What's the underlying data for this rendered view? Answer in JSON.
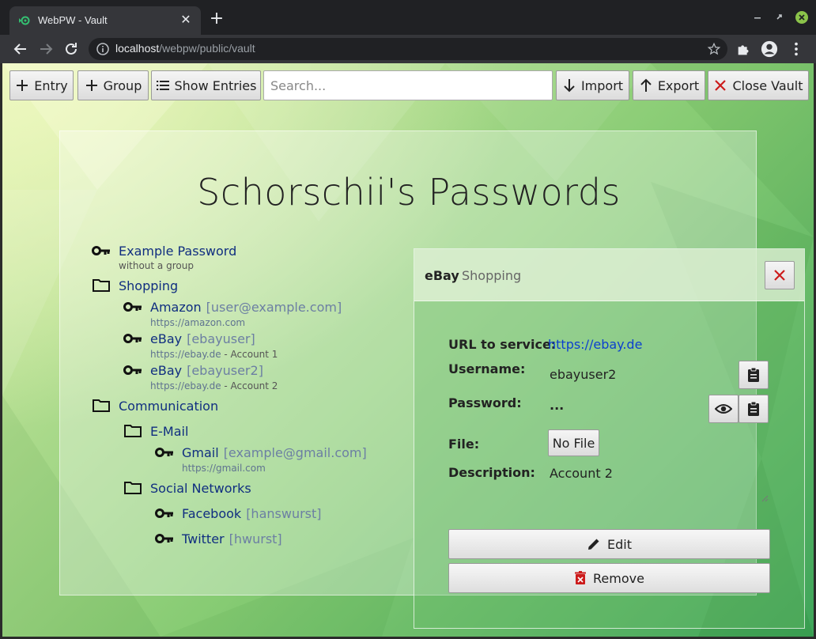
{
  "browser": {
    "tab_title": "WebPW - Vault",
    "tab_close": "✕",
    "new_tab": "+",
    "url_host": "localhost",
    "url_path": "/webpw/public/vault"
  },
  "topbar": {
    "entry_label": "Entry",
    "group_label": "Group",
    "show_entries_label": "Show Entries",
    "search_placeholder": "Search...",
    "import_label": "Import",
    "export_label": "Export",
    "close_vault_label": "Close Vault"
  },
  "vault": {
    "title": "Schorschii's Passwords",
    "tree": {
      "example": {
        "name": "Example Password",
        "sub": "without a group"
      },
      "shopping": {
        "name": "Shopping",
        "amazon": {
          "name": "Amazon",
          "user": "[user@example.com]",
          "url": "https://amazon.com"
        },
        "ebay1": {
          "name": "eBay",
          "user": "[ebayuser]",
          "url": "https://ebay.de",
          "desc": " - Account 1"
        },
        "ebay2": {
          "name": "eBay",
          "user": "[ebayuser2]",
          "url": "https://ebay.de",
          "desc": " - Account 2"
        }
      },
      "communication": {
        "name": "Communication",
        "email": {
          "name": "E-Mail",
          "gmail": {
            "name": "Gmail",
            "user": "[example@gmail.com]",
            "url": "https://gmail.com"
          }
        },
        "social": {
          "name": "Social Networks",
          "facebook": {
            "name": "Facebook",
            "user": "[hanswurst]"
          },
          "twitter": {
            "name": "Twitter",
            "user": "[hwurst]"
          }
        }
      }
    }
  },
  "detail": {
    "title": "eBay",
    "group": "Shopping",
    "url_label": "URL to service:",
    "url_value": "https://ebay.de",
    "username_label": "Username:",
    "username_value": "ebayuser2",
    "password_label": "Password:",
    "password_value": "...",
    "file_label": "File:",
    "file_button": "No File",
    "description_label": "Description:",
    "description_value": "Account 2",
    "edit_label": "Edit",
    "remove_label": "Remove"
  },
  "icons": {
    "key": "key-icon",
    "folder": "folder-icon",
    "clipboard": "clipboard-icon",
    "eye": "eye-icon",
    "pencil": "pencil-icon",
    "trash": "trash-icon"
  },
  "colors": {
    "link": "#102e80",
    "url_link": "#0b3fcf",
    "close_red": "#cc1b1b"
  }
}
